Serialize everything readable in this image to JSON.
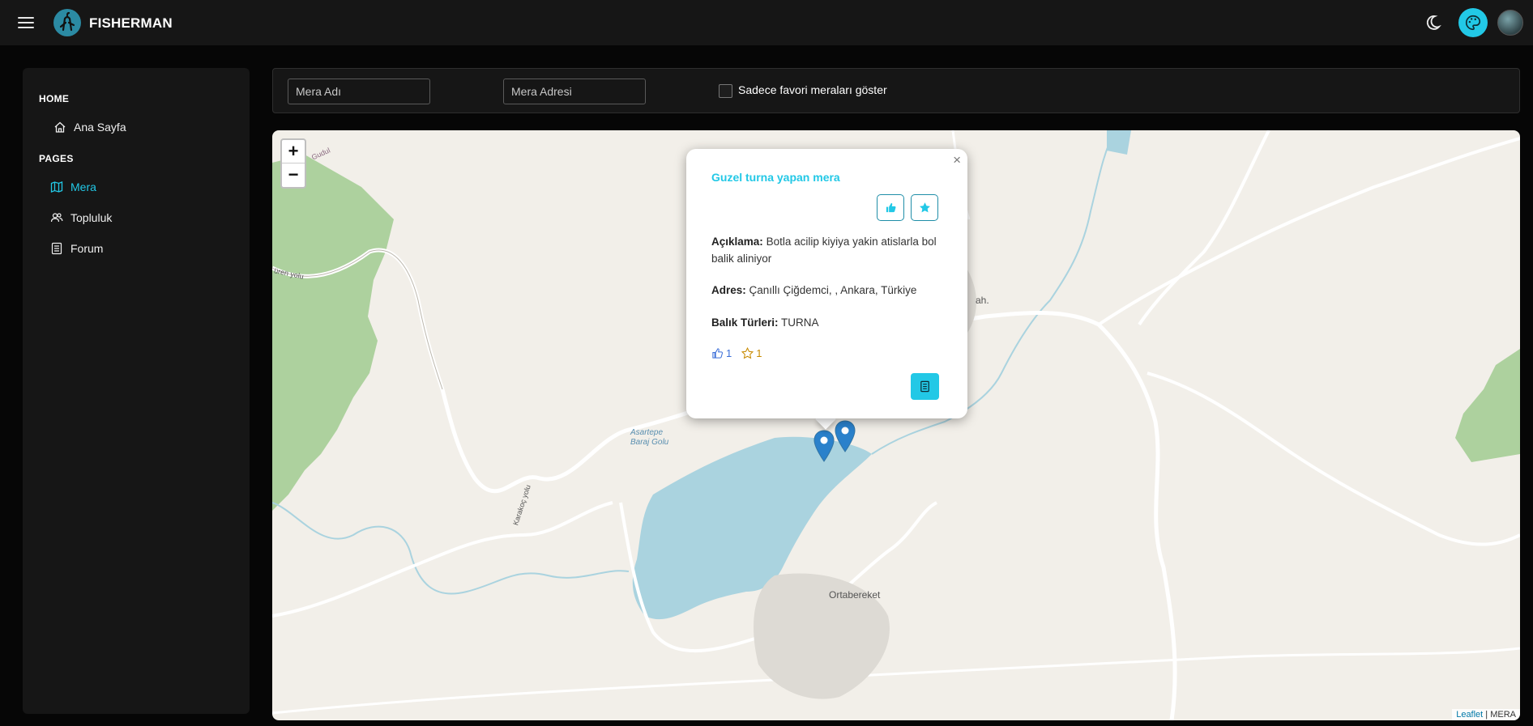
{
  "header": {
    "brand": "FISHERMAN",
    "icons": [
      "menu-icon",
      "logo-icon",
      "moon-icon",
      "palette-icon",
      "user-avatar"
    ]
  },
  "sidebar": {
    "sections": [
      {
        "title": "HOME",
        "items": [
          {
            "label": "Ana Sayfa",
            "icon": "home-icon",
            "active": false
          }
        ]
      },
      {
        "title": "PAGES",
        "items": [
          {
            "label": "Mera",
            "icon": "map-icon",
            "active": true
          },
          {
            "label": "Topluluk",
            "icon": "users-icon",
            "active": false
          },
          {
            "label": "Forum",
            "icon": "list-icon",
            "active": false
          }
        ]
      }
    ]
  },
  "filters": {
    "name_placeholder": "Mera Adı",
    "address_placeholder": "Mera Adresi",
    "favorites_label": "Sadece favori meraları göster"
  },
  "map": {
    "zoom_in": "+",
    "zoom_out": "−",
    "attribution_leaflet": "Leaflet",
    "attribution_sep": "|",
    "attribution_source": "MERA",
    "labels": {
      "lake": "Asartepe",
      "lake2": "Baraj Golu",
      "village": "Ortabereket",
      "road1": "Gudul",
      "road2": "üren yolu",
      "road3": "Karakoç yolu",
      "frag": "ah."
    }
  },
  "popup": {
    "close": "×",
    "title": "Guzel turna yapan mera",
    "desc_label": "Açıklama:",
    "desc_value": "Botla acilip kiyiya yakin atislarla bol balik aliniyor",
    "addr_label": "Adres:",
    "addr_value": "Çanıllı Çiğdemci, , Ankara, Türkiye",
    "fish_label": "Balık Türleri:",
    "fish_value": "TURNA",
    "likes": "1",
    "favs": "1"
  },
  "colors": {
    "accent": "#22c8e6",
    "map_bg": "#f2efe9",
    "water": "#aad3df",
    "forest": "#add19e"
  }
}
